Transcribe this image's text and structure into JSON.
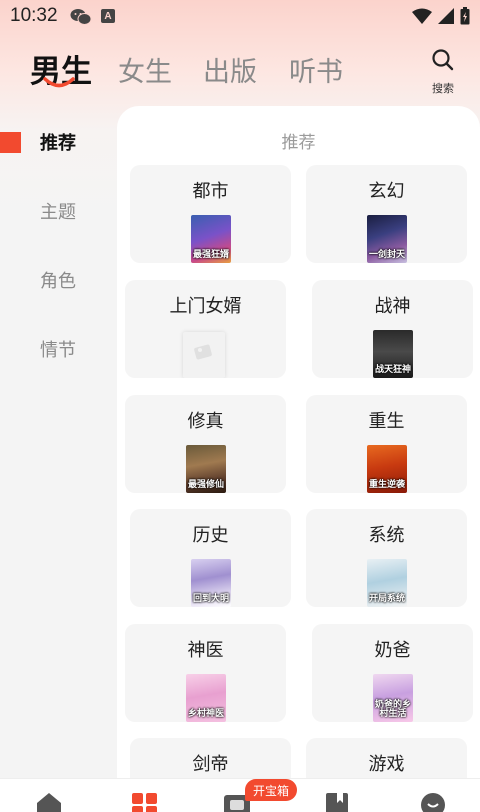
{
  "status_bar": {
    "time": "10:32",
    "a_label": "A",
    "icons": [
      "wechat-icon",
      "a-icon",
      "wifi-icon",
      "signal-icon",
      "battery-icon"
    ]
  },
  "header": {
    "tabs": [
      {
        "label": "男生",
        "active": true
      },
      {
        "label": "女生",
        "active": false
      },
      {
        "label": "出版",
        "active": false
      },
      {
        "label": "听书",
        "active": false
      }
    ],
    "search_label": "搜索"
  },
  "sidebar": {
    "items": [
      {
        "label": "推荐",
        "active": true
      },
      {
        "label": "主题",
        "active": false
      },
      {
        "label": "角色",
        "active": false
      },
      {
        "label": "情节",
        "active": false
      }
    ]
  },
  "main": {
    "title": "推荐",
    "categories": [
      {
        "label": "都市",
        "cover_text": "最强狂婿"
      },
      {
        "label": "玄幻",
        "cover_text": "一剑封天"
      },
      {
        "label": "上门女婿",
        "cover_text": ""
      },
      {
        "label": "战神",
        "cover_text": "战天狂神"
      },
      {
        "label": "修真",
        "cover_text": "最强修仙"
      },
      {
        "label": "重生",
        "cover_text": "重生逆袭"
      },
      {
        "label": "历史",
        "cover_text": "回到大明"
      },
      {
        "label": "系统",
        "cover_text": "开局系统"
      },
      {
        "label": "神医",
        "cover_text": "乡村神医"
      },
      {
        "label": "奶爸",
        "cover_text": "奶爸的乡村生活"
      },
      {
        "label": "剑帝",
        "cover_text": ""
      },
      {
        "label": "游戏",
        "cover_text": ""
      }
    ]
  },
  "bottom_nav": {
    "items": [
      "home-icon",
      "category-icon",
      "welfare-icon",
      "bookshelf-icon",
      "mine-icon"
    ],
    "badge": "开宝箱"
  },
  "colors": {
    "accent": "#f24a2f",
    "card_bg": "#f5f5f5",
    "inactive_text": "#8a8a8a"
  }
}
